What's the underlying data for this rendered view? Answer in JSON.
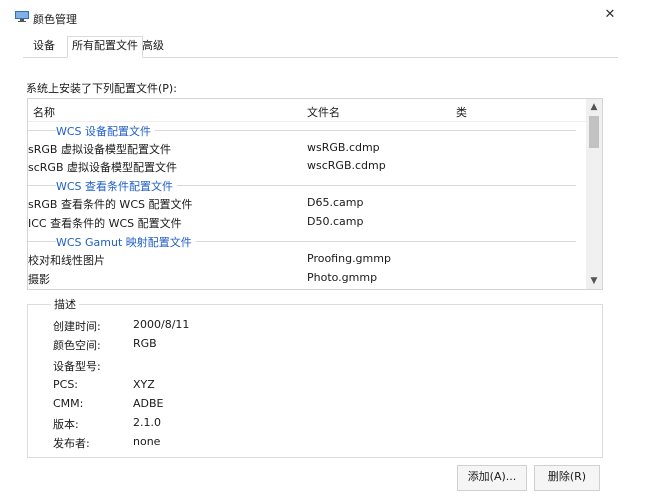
{
  "window": {
    "title": "颜色管理",
    "close_glyph": "✕"
  },
  "tabs": [
    {
      "label": "设备",
      "active": false
    },
    {
      "label": "所有配置文件",
      "active": true
    },
    {
      "label": "高级",
      "active": false
    }
  ],
  "installed_label": "系统上安装了下列配置文件(P):",
  "list": {
    "headers": {
      "name": "名称",
      "filename": "文件名",
      "class": "类"
    },
    "groups": [
      {
        "label": "WCS 设备配置文件",
        "rows": [
          {
            "name": "sRGB 虚拟设备模型配置文件",
            "file": "wsRGB.cdmp"
          },
          {
            "name": "scRGB 虚拟设备模型配置文件",
            "file": "wscRGB.cdmp"
          }
        ]
      },
      {
        "label": "WCS 查看条件配置文件",
        "rows": [
          {
            "name": "sRGB 查看条件的 WCS 配置文件",
            "file": "D65.camp"
          },
          {
            "name": "ICC 查看条件的 WCS 配置文件",
            "file": "D50.camp"
          }
        ]
      },
      {
        "label": "WCS Gamut 映射配置文件",
        "rows": [
          {
            "name": "校对和线性图片",
            "file": "Proofing.gmmp"
          },
          {
            "name": "摄影",
            "file": "Photo.gmmp"
          }
        ]
      }
    ]
  },
  "description": {
    "title": "描述",
    "fields": [
      {
        "label": "创建时间:",
        "value": "2000/8/11"
      },
      {
        "label": "颜色空间:",
        "value": "RGB"
      },
      {
        "label": "设备型号:",
        "value": ""
      },
      {
        "label": "PCS:",
        "value": "XYZ"
      },
      {
        "label": "CMM:",
        "value": "ADBE"
      },
      {
        "label": "版本:",
        "value": "2.1.0"
      },
      {
        "label": "发布者:",
        "value": "none"
      }
    ]
  },
  "buttons": {
    "add": "添加(A)...",
    "remove": "删除(R)"
  },
  "colors": {
    "group_label": "#1f5fc8",
    "accent": "#1f5fc8"
  }
}
